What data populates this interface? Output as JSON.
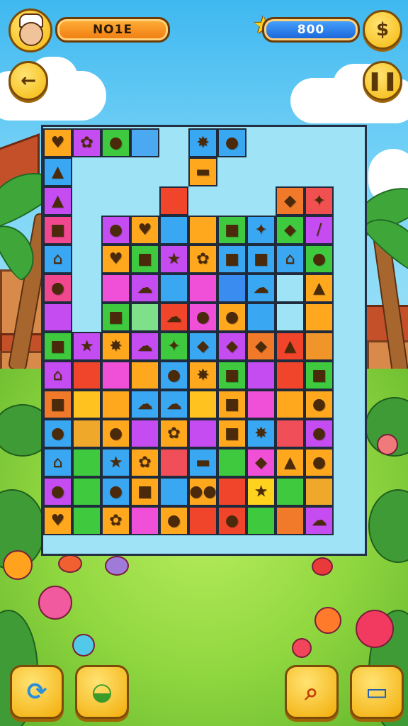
{
  "hud": {
    "player_name": "NO1E",
    "score": "800",
    "avatar_icon": "chef-avatar-icon",
    "star_icon": "star-icon",
    "settings_icon": "dollar-coin-icon",
    "back_icon": "back-arrow-icon",
    "pause_icon": "pause-icon"
  },
  "board": {
    "rows": 14,
    "cols": 11,
    "cells": [
      {
        "r": 0,
        "c": 0,
        "color": "#ffa81e",
        "icon": "♥"
      },
      {
        "r": 0,
        "c": 1,
        "color": "#c44cf0",
        "icon": "✿"
      },
      {
        "r": 0,
        "c": 2,
        "color": "#3ec93e",
        "icon": "●"
      },
      {
        "r": 0,
        "c": 3,
        "color": "#4aa9f0",
        "icon": ""
      },
      {
        "r": 0,
        "c": 5,
        "color": "#3aa7f3",
        "icon": "✸"
      },
      {
        "r": 0,
        "c": 6,
        "color": "#3aa7f3",
        "icon": "●"
      },
      {
        "r": 1,
        "c": 0,
        "color": "#3aa7f3",
        "icon": "▲"
      },
      {
        "r": 1,
        "c": 5,
        "color": "#ffa81e",
        "icon": "▬"
      },
      {
        "r": 2,
        "c": 0,
        "color": "#c44cf0",
        "icon": "▲"
      },
      {
        "r": 2,
        "c": 4,
        "color": "#f0452a",
        "icon": ""
      },
      {
        "r": 2,
        "c": 8,
        "color": "#f07a2a",
        "icon": "◆"
      },
      {
        "r": 2,
        "c": 9,
        "color": "#f05050",
        "icon": "✦"
      },
      {
        "r": 3,
        "c": 0,
        "color": "#f0478f",
        "icon": "■"
      },
      {
        "r": 3,
        "c": 2,
        "color": "#c44cf0",
        "icon": "●"
      },
      {
        "r": 3,
        "c": 3,
        "color": "#ffa81e",
        "icon": "♥"
      },
      {
        "r": 3,
        "c": 4,
        "color": "#3aa7f3",
        "icon": ""
      },
      {
        "r": 3,
        "c": 5,
        "color": "#ffa81e",
        "icon": ""
      },
      {
        "r": 3,
        "c": 6,
        "color": "#3ec93e",
        "icon": "■"
      },
      {
        "r": 3,
        "c": 7,
        "color": "#3aa7f3",
        "icon": "✦"
      },
      {
        "r": 3,
        "c": 8,
        "color": "#3ec93e",
        "icon": "◆"
      },
      {
        "r": 3,
        "c": 9,
        "color": "#c44cf0",
        "icon": "/"
      },
      {
        "r": 4,
        "c": 0,
        "color": "#3aa7f3",
        "icon": "⌂"
      },
      {
        "r": 4,
        "c": 2,
        "color": "#ffa81e",
        "icon": "♥"
      },
      {
        "r": 4,
        "c": 3,
        "color": "#3ec93e",
        "icon": "■"
      },
      {
        "r": 4,
        "c": 4,
        "color": "#c44cf0",
        "icon": "★"
      },
      {
        "r": 4,
        "c": 5,
        "color": "#ffa81e",
        "icon": "✿"
      },
      {
        "r": 4,
        "c": 6,
        "color": "#3aa7f3",
        "icon": "■"
      },
      {
        "r": 4,
        "c": 7,
        "color": "#3aa7f3",
        "icon": "■"
      },
      {
        "r": 4,
        "c": 8,
        "color": "#3aa7f3",
        "icon": "⌂"
      },
      {
        "r": 4,
        "c": 9,
        "color": "#3ec93e",
        "icon": "●"
      },
      {
        "r": 5,
        "c": 0,
        "color": "#f0478f",
        "icon": "●"
      },
      {
        "r": 5,
        "c": 2,
        "color": "#f04fd8",
        "icon": ""
      },
      {
        "r": 5,
        "c": 3,
        "color": "#c44cf0",
        "icon": "☁"
      },
      {
        "r": 5,
        "c": 4,
        "color": "#3aa7f3",
        "icon": ""
      },
      {
        "r": 5,
        "c": 5,
        "color": "#f04fd8",
        "icon": ""
      },
      {
        "r": 5,
        "c": 6,
        "color": "#3a8cf0",
        "icon": ""
      },
      {
        "r": 5,
        "c": 7,
        "color": "#3aa7f3",
        "icon": "☁"
      },
      {
        "r": 5,
        "c": 8,
        "color": "#9fe3f7",
        "icon": ""
      },
      {
        "r": 5,
        "c": 9,
        "color": "#ffa81e",
        "icon": "▲"
      },
      {
        "r": 6,
        "c": 0,
        "color": "#c44cf0",
        "icon": ""
      },
      {
        "r": 6,
        "c": 2,
        "color": "#3ec93e",
        "icon": "■"
      },
      {
        "r": 6,
        "c": 3,
        "color": "#7fe08a",
        "icon": ""
      },
      {
        "r": 6,
        "c": 4,
        "color": "#f0452a",
        "icon": "☁"
      },
      {
        "r": 6,
        "c": 5,
        "color": "#f04fd8",
        "icon": "●"
      },
      {
        "r": 6,
        "c": 6,
        "color": "#ffa81e",
        "icon": "●"
      },
      {
        "r": 6,
        "c": 7,
        "color": "#3aa7f3",
        "icon": ""
      },
      {
        "r": 6,
        "c": 8,
        "color": "#9fe3f7",
        "icon": ""
      },
      {
        "r": 6,
        "c": 9,
        "color": "#ffa81e",
        "icon": ""
      },
      {
        "r": 7,
        "c": 0,
        "color": "#3ec93e",
        "icon": "■"
      },
      {
        "r": 7,
        "c": 1,
        "color": "#c44cf0",
        "icon": "★"
      },
      {
        "r": 7,
        "c": 2,
        "color": "#ffa81e",
        "icon": "✸"
      },
      {
        "r": 7,
        "c": 3,
        "color": "#c44cf0",
        "icon": "☁"
      },
      {
        "r": 7,
        "c": 4,
        "color": "#3ec93e",
        "icon": "✦"
      },
      {
        "r": 7,
        "c": 5,
        "color": "#3aa7f3",
        "icon": "◆"
      },
      {
        "r": 7,
        "c": 6,
        "color": "#c44cf0",
        "icon": "◆"
      },
      {
        "r": 7,
        "c": 7,
        "color": "#f07a2a",
        "icon": "◆"
      },
      {
        "r": 7,
        "c": 8,
        "color": "#f0452a",
        "icon": "▲"
      },
      {
        "r": 7,
        "c": 9,
        "color": "#f0952a",
        "icon": ""
      },
      {
        "r": 8,
        "c": 0,
        "color": "#c44cf0",
        "icon": "⌂"
      },
      {
        "r": 8,
        "c": 1,
        "color": "#f0452a",
        "icon": ""
      },
      {
        "r": 8,
        "c": 2,
        "color": "#f04fd8",
        "icon": ""
      },
      {
        "r": 8,
        "c": 3,
        "color": "#ffa81e",
        "icon": ""
      },
      {
        "r": 8,
        "c": 4,
        "color": "#3aa7f3",
        "icon": "●"
      },
      {
        "r": 8,
        "c": 5,
        "color": "#ffa81e",
        "icon": "✸"
      },
      {
        "r": 8,
        "c": 6,
        "color": "#3ec93e",
        "icon": "■"
      },
      {
        "r": 8,
        "c": 7,
        "color": "#c44cf0",
        "icon": ""
      },
      {
        "r": 8,
        "c": 8,
        "color": "#f0452a",
        "icon": ""
      },
      {
        "r": 8,
        "c": 9,
        "color": "#3ec93e",
        "icon": "■"
      },
      {
        "r": 9,
        "c": 0,
        "color": "#f07a2a",
        "icon": "■"
      },
      {
        "r": 9,
        "c": 1,
        "color": "#ffc21e",
        "icon": ""
      },
      {
        "r": 9,
        "c": 2,
        "color": "#ffa81e",
        "icon": ""
      },
      {
        "r": 9,
        "c": 3,
        "color": "#3aa7f3",
        "icon": "☁"
      },
      {
        "r": 9,
        "c": 4,
        "color": "#3aa7f3",
        "icon": "☁"
      },
      {
        "r": 9,
        "c": 5,
        "color": "#ffc21e",
        "icon": ""
      },
      {
        "r": 9,
        "c": 6,
        "color": "#ffa81e",
        "icon": "■"
      },
      {
        "r": 9,
        "c": 7,
        "color": "#f04fd8",
        "icon": ""
      },
      {
        "r": 9,
        "c": 8,
        "color": "#ffa81e",
        "icon": ""
      },
      {
        "r": 9,
        "c": 9,
        "color": "#ffa81e",
        "icon": "●"
      },
      {
        "r": 10,
        "c": 0,
        "color": "#3aa7f3",
        "icon": "●"
      },
      {
        "r": 10,
        "c": 1,
        "color": "#f0a82a",
        "icon": ""
      },
      {
        "r": 10,
        "c": 2,
        "color": "#ffa81e",
        "icon": "●"
      },
      {
        "r": 10,
        "c": 3,
        "color": "#c44cf0",
        "icon": ""
      },
      {
        "r": 10,
        "c": 4,
        "color": "#ffa81e",
        "icon": "✿"
      },
      {
        "r": 10,
        "c": 5,
        "color": "#c44cf0",
        "icon": ""
      },
      {
        "r": 10,
        "c": 6,
        "color": "#ffa81e",
        "icon": "■"
      },
      {
        "r": 10,
        "c": 7,
        "color": "#3aa7f3",
        "icon": "✸"
      },
      {
        "r": 10,
        "c": 8,
        "color": "#f04f5a",
        "icon": ""
      },
      {
        "r": 10,
        "c": 9,
        "color": "#c44cf0",
        "icon": "●"
      },
      {
        "r": 11,
        "c": 0,
        "color": "#3aa7f3",
        "icon": "⌂"
      },
      {
        "r": 11,
        "c": 1,
        "color": "#3ec93e",
        "icon": ""
      },
      {
        "r": 11,
        "c": 2,
        "color": "#3aa7f3",
        "icon": "★"
      },
      {
        "r": 11,
        "c": 3,
        "color": "#ffa81e",
        "icon": "✿"
      },
      {
        "r": 11,
        "c": 4,
        "color": "#f04f5a",
        "icon": ""
      },
      {
        "r": 11,
        "c": 5,
        "color": "#3aa7f3",
        "icon": "▬"
      },
      {
        "r": 11,
        "c": 6,
        "color": "#3ec93e",
        "icon": ""
      },
      {
        "r": 11,
        "c": 7,
        "color": "#f04fd8",
        "icon": "◆"
      },
      {
        "r": 11,
        "c": 8,
        "color": "#ffa81e",
        "icon": "▲"
      },
      {
        "r": 11,
        "c": 9,
        "color": "#ffa81e",
        "icon": "●"
      },
      {
        "r": 12,
        "c": 0,
        "color": "#c44cf0",
        "icon": "●"
      },
      {
        "r": 12,
        "c": 1,
        "color": "#3ec93e",
        "icon": ""
      },
      {
        "r": 12,
        "c": 2,
        "color": "#3aa7f3",
        "icon": "●"
      },
      {
        "r": 12,
        "c": 3,
        "color": "#ffa81e",
        "icon": "■"
      },
      {
        "r": 12,
        "c": 4,
        "color": "#3aa7f3",
        "icon": ""
      },
      {
        "r": 12,
        "c": 5,
        "color": "#ffa81e",
        "icon": "●●"
      },
      {
        "r": 12,
        "c": 6,
        "color": "#f0452a",
        "icon": ""
      },
      {
        "r": 12,
        "c": 7,
        "color": "#ffd21e",
        "icon": "★"
      },
      {
        "r": 12,
        "c": 8,
        "color": "#3ec93e",
        "icon": ""
      },
      {
        "r": 12,
        "c": 9,
        "color": "#f0a82a",
        "icon": ""
      },
      {
        "r": 13,
        "c": 0,
        "color": "#ffa81e",
        "icon": "♥"
      },
      {
        "r": 13,
        "c": 1,
        "color": "#3ec93e",
        "icon": ""
      },
      {
        "r": 13,
        "c": 2,
        "color": "#ffa81e",
        "icon": "✿"
      },
      {
        "r": 13,
        "c": 3,
        "color": "#f04fd8",
        "icon": ""
      },
      {
        "r": 13,
        "c": 4,
        "color": "#ffa81e",
        "icon": "●"
      },
      {
        "r": 13,
        "c": 5,
        "color": "#f0452a",
        "icon": ""
      },
      {
        "r": 13,
        "c": 6,
        "color": "#f0452a",
        "icon": "●"
      },
      {
        "r": 13,
        "c": 7,
        "color": "#3ec93e",
        "icon": ""
      },
      {
        "r": 13,
        "c": 8,
        "color": "#f07a2a",
        "icon": ""
      },
      {
        "r": 13,
        "c": 9,
        "color": "#c44cf0",
        "icon": "☁"
      }
    ]
  },
  "buttons": {
    "swap_icon": "refresh-icon",
    "food_icon": "food-bowl-icon",
    "hint_icon": "magnifier-icon",
    "cards_icon": "cards-icon"
  }
}
